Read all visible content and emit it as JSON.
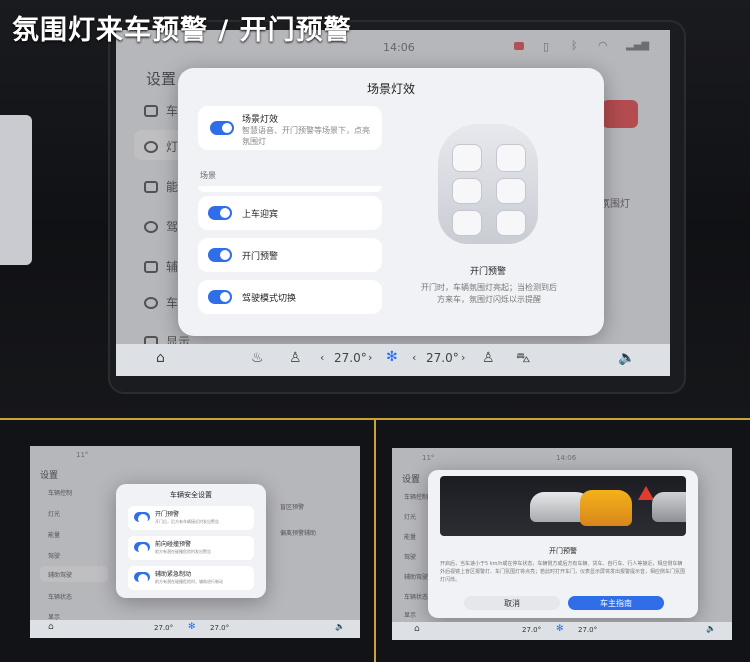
{
  "banner": "氛围灯来车预警 / 开门预警",
  "top": {
    "time": "14:06",
    "settings_title": "设置",
    "sidebar": [
      "车辆控",
      "灯光",
      "能量",
      "驾驶",
      "辅助驾",
      "车辆状",
      "显示"
    ],
    "right_hint": "氛围灯",
    "dialog": {
      "title": "场景灯效",
      "main_label": "场景灯效",
      "main_desc": "智慧语音、开门预警等场景下，点亮氛围灯",
      "section": "场景",
      "items": [
        "上车迎宾",
        "开门预警",
        "驾驶模式切换"
      ],
      "preview_title": "开门预警",
      "preview_desc": "开门时，车辆氛围灯亮起；当检测到后方来车，氛围灯闪烁以示提醒"
    },
    "dock": {
      "temp_left": "27.0°",
      "temp_right": "27.0°"
    }
  },
  "bottom_left": {
    "status_temp": "11°",
    "settings_title": "设置",
    "sidebar": [
      "车辆控制",
      "灯光",
      "能量",
      "驾驶",
      "辅助驾驶",
      "车辆状态",
      "显示"
    ],
    "dialog": {
      "title": "车辆安全设置",
      "items": [
        {
          "label": "开门预警",
          "desc": "开门后，后方有车辆接近时发出警告"
        },
        {
          "label": "前向碰撞预警",
          "desc": "前方有潜在碰撞危险时发出警告"
        },
        {
          "label": "辅助紧急制动",
          "desc": "前方有潜在碰撞危险时，辅助进行制动"
        }
      ]
    },
    "behind": [
      "盲区预警",
      "偏离预警辅助"
    ],
    "dock": {
      "temp_left": "27.0°",
      "temp_right": "27.0°"
    }
  },
  "bottom_right": {
    "status_temp": "11°",
    "time": "14:06",
    "settings_title": "设置",
    "sidebar": [
      "车辆控制",
      "灯光",
      "能量",
      "驾驶",
      "辅助驾驶",
      "车辆状态",
      "显示"
    ],
    "dialog": {
      "title": "开门预警",
      "desc": "开启后，当车速小于5 km/h或在停车状态，车辆侧方或后方有车辆、货车、自行车、行人等接近，相应侧车辆外后视镜上盲区报警灯、车门氛围灯将点亮；若此时打开车门，仪表显示屏将发出报警提示音，相应侧车门氛围灯闪烁。",
      "cancel": "取消",
      "confirm": "车主指南"
    },
    "dock": {
      "temp_left": "27.0°",
      "temp_right": "27.0°"
    }
  }
}
